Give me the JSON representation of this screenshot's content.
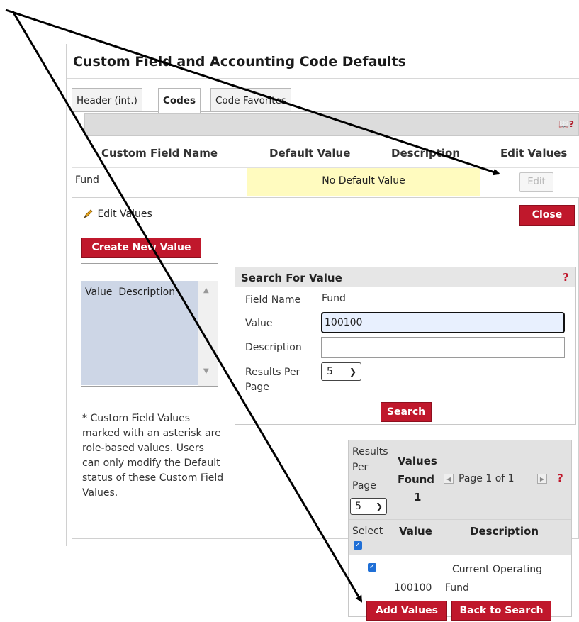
{
  "page": {
    "title": "Custom Field and Accounting Code Defaults"
  },
  "tabs": [
    {
      "label": "Header (int.)"
    },
    {
      "label": "Codes"
    },
    {
      "label": "Code Favorites"
    }
  ],
  "help_mark": "?",
  "codes_table": {
    "headers": [
      "Custom Field Name",
      "Default Value",
      "Description",
      "Edit Values"
    ],
    "row": {
      "field": "Fund",
      "default": "No Default Value",
      "edit_label": "Edit"
    }
  },
  "edit_panel": {
    "title": "Edit Values",
    "close_label": "Close",
    "create_label": "Create New Value",
    "list_header_value": "Value",
    "list_header_desc": "Description",
    "note": "* Custom Field Values marked with an asterisk are role-based values. Users can only modify the Default status of these Custom Field Values."
  },
  "search": {
    "title": "Search For Value",
    "help": "?",
    "field_name_label": "Field Name",
    "field_name_value": "Fund",
    "value_label": "Value",
    "value_input": "100100",
    "description_label": "Description",
    "description_input": "",
    "results_per_page_label_1": "Results Per",
    "results_per_page_label_2": "Page",
    "results_per_page_value": "5",
    "search_label": "Search"
  },
  "results": {
    "rpp_label_1": "Results",
    "rpp_label_2": "Per",
    "rpp_label_3": "Page",
    "rpp_value": "5",
    "found_label_1": "Values",
    "found_label_2": "Found",
    "found_count": "1",
    "page_text": "Page 1 of 1",
    "help": "?",
    "col_select": "Select",
    "col_value": "Value",
    "col_description": "Description",
    "row_value": "100100",
    "row_desc_1": "Current Operating",
    "row_desc_2": "Fund",
    "add_label": "Add Values",
    "back_label": "Back to Search"
  },
  "colors": {
    "accent_red": "#c0182c",
    "highlight_yellow": "#fffbbf",
    "list_blue": "#cdd6e6",
    "checkbox_blue": "#1f6fd6"
  }
}
